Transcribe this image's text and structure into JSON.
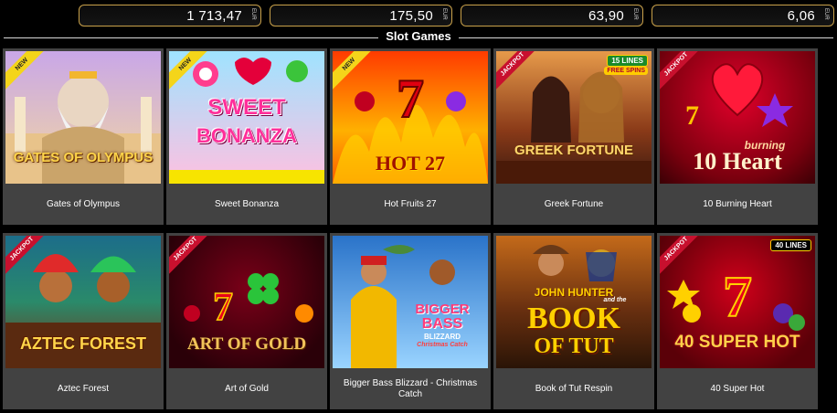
{
  "jackpots": [
    {
      "amount": "1 713,47",
      "currency": "EUR"
    },
    {
      "amount": "175,50",
      "currency": "EUR"
    },
    {
      "amount": "63,90",
      "currency": "EUR"
    },
    {
      "amount": "6,06",
      "currency": "EUR"
    }
  ],
  "section": {
    "title": "Slot Games"
  },
  "games": [
    {
      "name": "Gates of Olympus",
      "ribbon": "NEW",
      "logo": "GATES OF OLYMPUS",
      "colors": {
        "bg1": "#c9a7e8",
        "bg2": "#f3d7a0",
        "logo": "#ffd54a"
      }
    },
    {
      "name": "Sweet Bonanza",
      "ribbon": "NEW",
      "logo_line1": "SWEET",
      "logo_line2": "BONANZA",
      "colors": {
        "bg1": "#9fe3ff",
        "bg2": "#ffc0e0",
        "logo": "#ff2f9a"
      }
    },
    {
      "name": "Hot Fruits 27",
      "ribbon": "NEW",
      "logo": "HOT 27",
      "colors": {
        "bg1": "#ff3b00",
        "bg2": "#ffb000",
        "logo": "#a01000"
      }
    },
    {
      "name": "Greek Fortune",
      "ribbon": "JACKPOT",
      "logo": "GREEK FORTUNE",
      "colors": {
        "bg1": "#c06a2a",
        "bg2": "#3a1a10",
        "logo": "#ffd76b"
      }
    },
    {
      "name": "10 Burning Heart",
      "ribbon": "JACKPOT",
      "logo_line1": "burning",
      "logo_line2": "10 Heart",
      "colors": {
        "bg1": "#c0001a",
        "bg2": "#5a0008",
        "logo": "#ffd8a0"
      }
    },
    {
      "name": "Aztec Forest",
      "ribbon": "JACKPOT",
      "logo": "AZTEC FOREST",
      "colors": {
        "bg1": "#1c6d8a",
        "bg2": "#7a2a10",
        "logo": "#ffd54a"
      }
    },
    {
      "name": "Art of Gold",
      "ribbon": "JACKPOT",
      "logo": "ART OF GOLD",
      "colors": {
        "bg1": "#5a0010",
        "bg2": "#1a0005",
        "logo": "#f2c35a"
      }
    },
    {
      "name": "Bigger Bass Blizzard - Christmas Catch",
      "ribbon": "",
      "logo_line1": "BIGGER",
      "logo_line2": "BASS",
      "logo_line3": "BLIZZARD",
      "logo_line4": "Christmas Catch",
      "colors": {
        "bg1": "#2a73c9",
        "bg2": "#9ad4ff",
        "logo": "#ff3d7a"
      }
    },
    {
      "name": "Book of Tut Respin",
      "ribbon": "",
      "logo_line1": "JOHN HUNTER",
      "logo_line2": "and the",
      "logo_line3": "BOOK",
      "logo_line4": "OF TUT",
      "colors": {
        "bg1": "#c46a1a",
        "bg2": "#2a1406",
        "logo": "#ffd000"
      }
    },
    {
      "name": "40 Super Hot",
      "ribbon": "JACKPOT",
      "logo": "40 SUPER HOT",
      "colors": {
        "bg1": "#a00010",
        "bg2": "#3a0005",
        "logo": "#ffd04a"
      }
    }
  ],
  "badges": {
    "greek_lines": "15 LINES",
    "greek_free": "FREE SPINS",
    "super_hot_lines": "40 LINES"
  },
  "icons": [
    "euro-currency-icon",
    "seven-icon",
    "heart-icon",
    "clover-icon",
    "cherry-icon",
    "fish-icon"
  ]
}
